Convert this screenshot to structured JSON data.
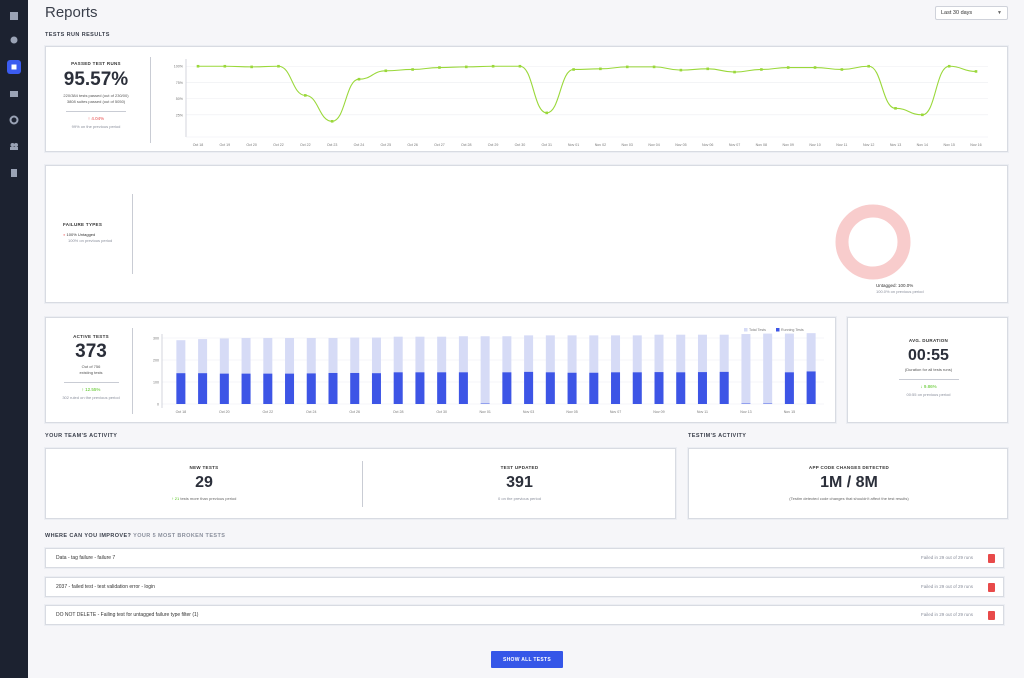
{
  "page": {
    "title": "Reports"
  },
  "date_range": {
    "selected": "Last 30 days"
  },
  "sections": {
    "runs": "TESTS RUN RESULTS",
    "team": "YOUR TEAM'S ACTIVITY",
    "testim": "TESTIM'S ACTIVITY",
    "improve_prefix": "WHERE CAN YOU IMPROVE?",
    "improve_suffix": "YOUR 5 MOST BROKEN TESTS"
  },
  "passed": {
    "title": "PASSED TEST RUNS",
    "value": "95.57%",
    "sub1": "220/384 tests passed (out of 230/00)",
    "sub2": "3808 suites passed (out of 5050)",
    "delta": "4.04%",
    "prev": "99% on the previous period"
  },
  "chart_data": [
    {
      "type": "line",
      "x": [
        "Oct 18",
        "Oct 19",
        "Oct 20",
        "Oct 22",
        "Oct 22",
        "Oct 23",
        "Oct 24",
        "Oct 25",
        "Oct 26",
        "Oct 27",
        "Oct 28",
        "Oct 29",
        "Oct 30",
        "Oct 31",
        "Nov 01",
        "Nov 02",
        "Nov 03",
        "Nov 04",
        "Nov 05",
        "Nov 06",
        "Nov 07",
        "Nov 08",
        "Nov 09",
        "Nov 10",
        "Nov 11",
        "Nov 12",
        "Nov 13",
        "Nov 14",
        "Nov 15",
        "Nov 16"
      ],
      "yticks": [
        "100%",
        "75%",
        "50%",
        "25%"
      ],
      "values": [
        100,
        100,
        99,
        100,
        55,
        15,
        80,
        93,
        95,
        98,
        99,
        100,
        100,
        28,
        95,
        96,
        99,
        99,
        94,
        96,
        91,
        95,
        98,
        98,
        95,
        100,
        35,
        25,
        100,
        92
      ],
      "ylim": [
        0,
        105
      ],
      "color": "#9ad83a"
    },
    {
      "type": "bar",
      "legend": [
        "Total Tests",
        "Running Tests"
      ],
      "yticks": [
        "300",
        "200",
        "100",
        "0"
      ],
      "ylim": [
        0,
        300
      ],
      "x_labels": [
        "Oct 18",
        "Oct 20",
        "Oct 22",
        "Oct 24",
        "Oct 26",
        "Oct 28",
        "Oct 30",
        "Nov 01",
        "Nov 03",
        "Nov 05",
        "Nov 07",
        "Nov 09",
        "Nov 11",
        "Nov 13",
        "Nov 15"
      ],
      "total": [
        290,
        295,
        298,
        300,
        300,
        300,
        300,
        300,
        302,
        302,
        306,
        306,
        306,
        308,
        308,
        308,
        312,
        312,
        312,
        312,
        312,
        312,
        315,
        315,
        315,
        315,
        318,
        320,
        320,
        322
      ],
      "running": [
        140,
        140,
        138,
        138,
        138,
        138,
        139,
        141,
        141,
        140,
        144,
        144,
        144,
        144,
        2,
        144,
        146,
        144,
        142,
        142,
        144,
        144,
        145,
        144,
        145,
        146,
        2,
        2,
        144,
        148
      ],
      "colors": {
        "total": "#d6dbf6",
        "running": "#3d55e6"
      }
    },
    {
      "type": "pie",
      "labels": [
        "Untagged"
      ],
      "values": [
        100
      ],
      "color": "#f8cccc"
    }
  ],
  "failure": {
    "title": "FAILURE TYPES",
    "item": "100% Untagged",
    "prev": "100% on previous period",
    "donut_label": "Untagged: 100.0%",
    "donut_prev": "100.0% on previous period"
  },
  "active": {
    "title": "ACTIVE TESTS",
    "value": "373",
    "sub1": "Out of 756",
    "sub2": "existing tests",
    "delta": "12.55%",
    "prev": "302 ruled on the previous period"
  },
  "duration": {
    "title": "AVG. DURATION",
    "value": "00:55",
    "sub": "(Duration for all tests runs)",
    "delta": "9.86%",
    "prev": "00:55 on previous period"
  },
  "team": {
    "new_title": "NEW TESTS",
    "new_value": "29",
    "new_delta": "21",
    "new_delta_text": "tests more than previous period",
    "upd_title": "TEST UPDATED",
    "upd_value": "391",
    "upd_prev": "0 on the previous period"
  },
  "testim": {
    "title": "APP CODE CHANGES DETECTED",
    "value": "1M / 8M",
    "sub": "(Testim detected code changes that shouldn't affect the test results)"
  },
  "broken": [
    {
      "name": "Data - tag failure - failure 7",
      "runs": "Failed in 29 out of 29 runs"
    },
    {
      "name": "2037 - failed test - test validation error - login",
      "runs": "Failed in 29 out of 29 runs"
    },
    {
      "name": "DO NOT DELETE - Failing test for untagged failure type filter (1)",
      "runs": "Failed in 29 out of 29 runs"
    }
  ],
  "show_all": "SHOW ALL TESTS",
  "colors": {
    "accent": "#3556e8",
    "green": "#52c41a",
    "red": "#e84a4a"
  }
}
